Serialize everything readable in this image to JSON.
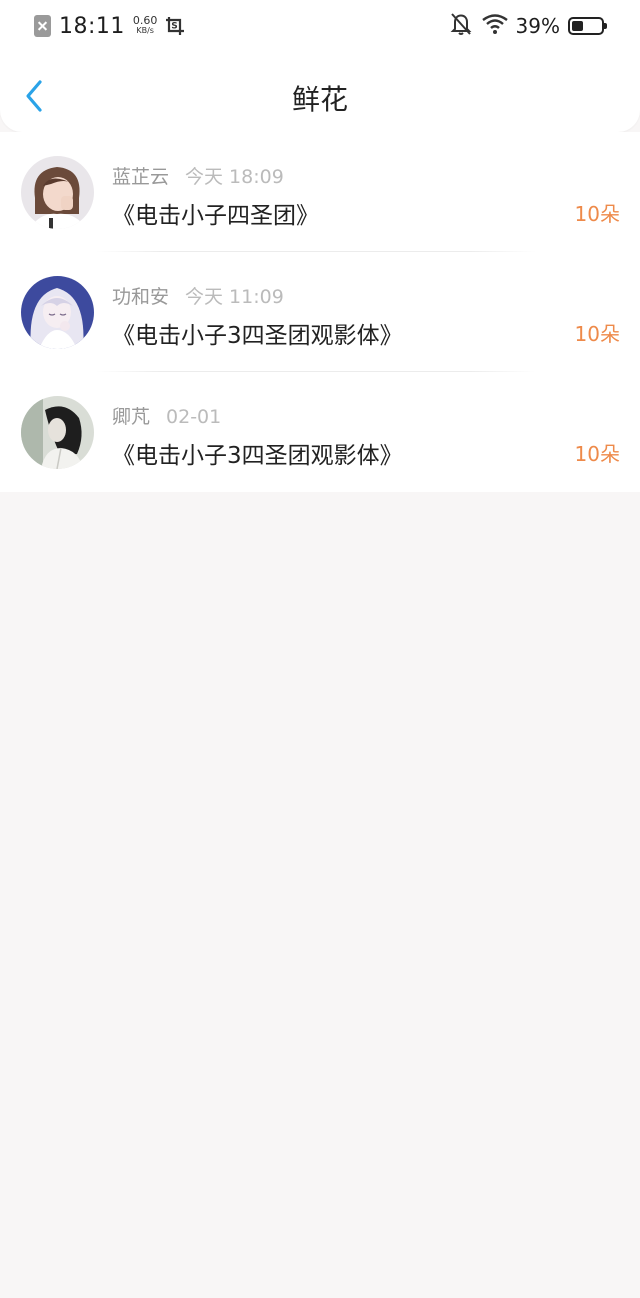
{
  "status_bar": {
    "time": "18:11",
    "net_speed_value": "0.60",
    "net_speed_unit": "KB/s",
    "battery_percent": "39%",
    "battery_level": 0.39
  },
  "header": {
    "title": "鲜花"
  },
  "colors": {
    "accent_back": "#2aa3e8",
    "count_orange": "#ee8a4a"
  },
  "list": [
    {
      "name": "蓝芷云",
      "time": "今天 18:09",
      "title": "《电击小子四圣团》",
      "count": "10朵"
    },
    {
      "name": "功和安",
      "time": "今天 11:09",
      "title": "《电击小子3四圣团观影体》",
      "count": "10朵"
    },
    {
      "name": "卿芃",
      "time": "02-01",
      "title": "《电击小子3四圣团观影体》",
      "count": "10朵"
    }
  ]
}
